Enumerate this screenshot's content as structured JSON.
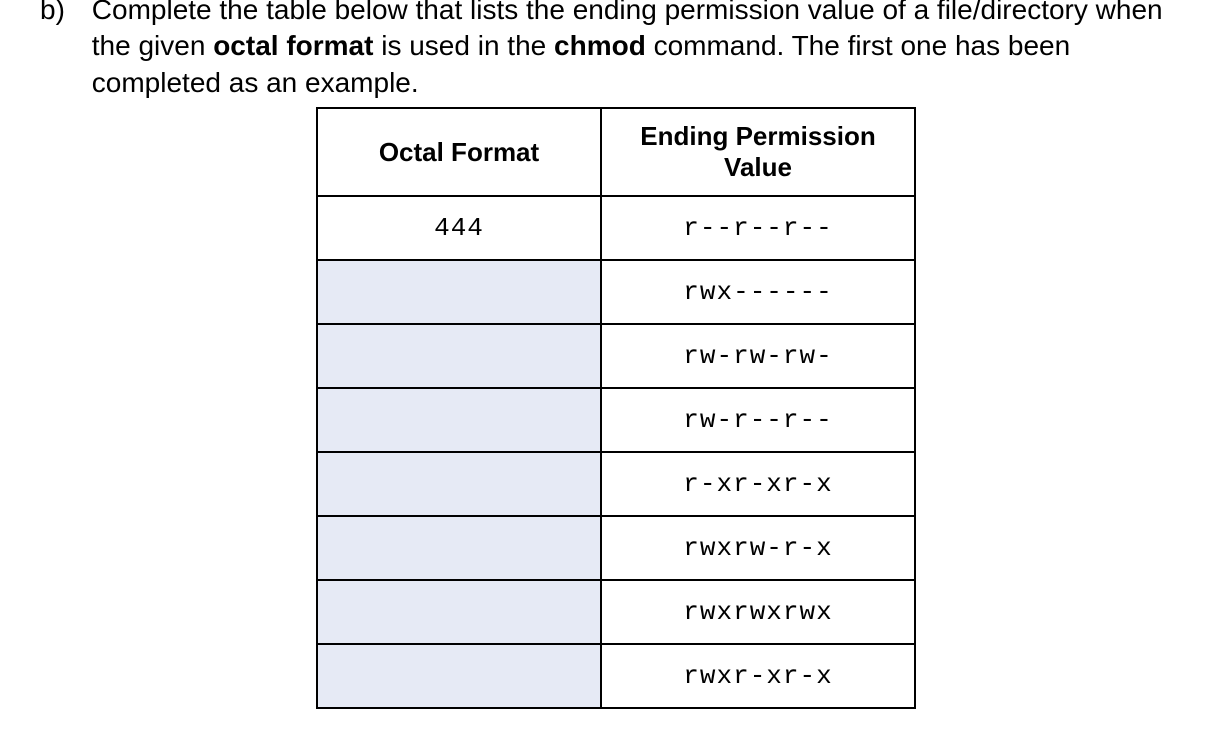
{
  "question": {
    "marker": "b)",
    "text_before_bold1": "Complete the table below that lists the ending permission value of a file/directory when the given ",
    "bold1": "octal format",
    "text_mid": " is used in the ",
    "bold2": "chmod",
    "text_after_bold2": " command. The first one has been completed as an example."
  },
  "table": {
    "headers": {
      "octal": "Octal Format",
      "perm": "Ending Permission Value"
    },
    "rows": [
      {
        "octal": "444",
        "perm": "r--r--r--",
        "blank": false
      },
      {
        "octal": "",
        "perm": "rwx------",
        "blank": true
      },
      {
        "octal": "",
        "perm": "rw-rw-rw-",
        "blank": true
      },
      {
        "octal": "",
        "perm": "rw-r--r--",
        "blank": true
      },
      {
        "octal": "",
        "perm": "r-xr-xr-x",
        "blank": true
      },
      {
        "octal": "",
        "perm": "rwxrw-r-x",
        "blank": true
      },
      {
        "octal": "",
        "perm": "rwxrwxrwx",
        "blank": true
      },
      {
        "octal": "",
        "perm": "rwxr-xr-x",
        "blank": true
      }
    ]
  }
}
